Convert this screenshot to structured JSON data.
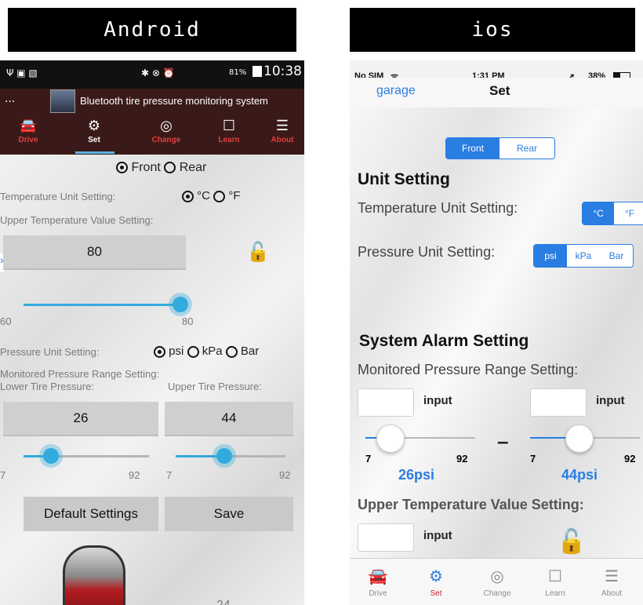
{
  "android_header": "Android",
  "ios_header": "ios",
  "android": {
    "status": {
      "left_icons": "Ψ ▣ ▧",
      "right_icons": "✱ ⊗ ⏰",
      "signal": "81%",
      "time": "10:38"
    },
    "title": "Bluetooth tire pressure monitoring system",
    "overflow": "...",
    "nav": [
      {
        "label": "Drive",
        "icon": "🚘"
      },
      {
        "label": "Set",
        "icon": "⚙"
      },
      {
        "label": "Change",
        "icon": "◎"
      },
      {
        "label": "Learn",
        "icon": "☐"
      },
      {
        "label": "About",
        "icon": "☰"
      }
    ],
    "position": {
      "front": "Front",
      "rear": "Rear"
    },
    "temp_unit_label": "Temperature Unit Setting:",
    "temp_unit_c": "°C",
    "temp_unit_f": "°F",
    "upper_temp_label": "Upper Temperature Value Setting:",
    "upper_temp_value": "80",
    "temp_slider": {
      "min": "60",
      "max": "80",
      "value": 1.0
    },
    "pressure_unit_label": "Pressure Unit Setting:",
    "pressure_units": [
      "psi",
      "kPa",
      "Bar"
    ],
    "monitored_label": "Monitored Pressure Range Setting:",
    "lower_label": "Lower Tire Pressure:",
    "upper_label": "Upper Tire Pressure:",
    "lower_value": "26",
    "upper_value": "44",
    "lower_slider": {
      "min": "7",
      "max": "92",
      "value": 0.22
    },
    "upper_slider": {
      "min": "7",
      "max": "92",
      "value": 0.44
    },
    "default_button": "Default Settings",
    "save_button": "Save",
    "bottom_partial": "24"
  },
  "ios": {
    "status": {
      "carrier": "No SIM",
      "time": "1:31 PM",
      "battery": "38%"
    },
    "nav_back": "garage",
    "nav_title": "Set",
    "seg_front": "Front",
    "seg_rear": "Rear",
    "unit_setting_title": "Unit Setting",
    "temp_unit_label": "Temperature Unit Setting:",
    "temp_c": "°C",
    "temp_f": "°F",
    "pressure_unit_label": "Pressure Unit Setting:",
    "pressure_psi": "psi",
    "pressure_kpa": "kPa",
    "pressure_bar": "Bar",
    "alarm_title": "System Alarm Setting",
    "monitored_label": "Monitored Pressure Range Setting:",
    "input_label": "input",
    "dash": "–",
    "lower": {
      "min": "7",
      "max": "92",
      "value_text": "26psi",
      "value": 0.22
    },
    "upper": {
      "min": "7",
      "max": "92",
      "value_text": "44psi",
      "value": 0.44
    },
    "upper_temp_label": "Upper Temperature Value Setting:",
    "tabs": [
      {
        "label": "Drive",
        "icon": "🚘"
      },
      {
        "label": "Set",
        "icon": "⚙"
      },
      {
        "label": "Change",
        "icon": "◎"
      },
      {
        "label": "Learn",
        "icon": "☐"
      },
      {
        "label": "About",
        "icon": "☰"
      }
    ]
  }
}
